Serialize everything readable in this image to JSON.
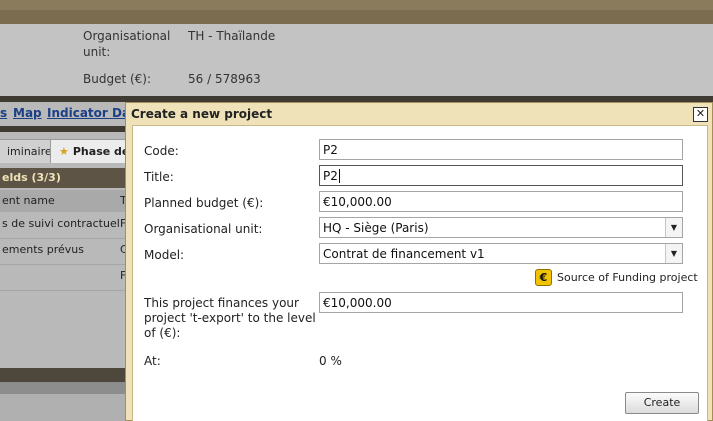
{
  "background": {
    "info": {
      "org_label_line1": "Organisational",
      "org_label_line2": "unit:",
      "org_value": "TH - Thaïlande",
      "budget_label": "Budget (€):",
      "budget_value": "56 / 578963"
    },
    "nav": {
      "item_partial": "s",
      "map": "Map",
      "indicator": "Indicator Data"
    },
    "tabs": [
      {
        "label": "iminaire"
      },
      {
        "label": "Phase de"
      }
    ],
    "fields_header": "elds (3/3)",
    "col_header": "ent name",
    "col_header_partial": "T",
    "rows": [
      {
        "name": "s de suivi contractuel",
        "type": "F"
      },
      {
        "name": "ements prévus",
        "type": "C"
      },
      {
        "name": "",
        "type": "F"
      }
    ]
  },
  "dialog": {
    "title": "Create a new project",
    "close_label": "✕",
    "fields": {
      "code": {
        "label": "Code:",
        "value": "P2"
      },
      "title": {
        "label": "Title:",
        "value": "P2"
      },
      "budget": {
        "label": "Planned budget (€):",
        "value": "€10,000.00"
      },
      "org_unit": {
        "label": "Organisational unit:",
        "value": "HQ - Siège (Paris)"
      },
      "model": {
        "label": "Model:",
        "value": "Contrat de financement v1"
      },
      "finances": {
        "label_line1": "This project finances your",
        "label_line2": "project 't-export' to the level",
        "label_line3": "of (€):",
        "value": "€10,000.00"
      },
      "at": {
        "label": "At:",
        "value": "0 %"
      }
    },
    "funding_source": {
      "icon": "euro-icon",
      "label": "Source of Funding project"
    },
    "create_button": "Create"
  }
}
